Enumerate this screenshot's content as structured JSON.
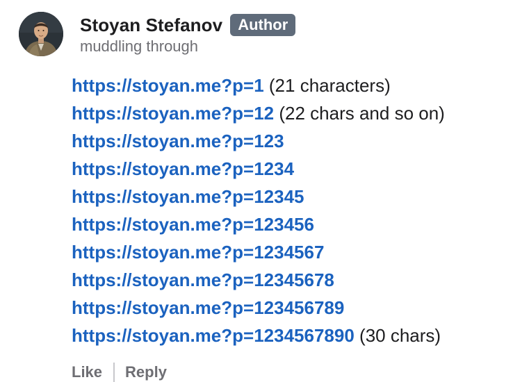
{
  "author": {
    "name": "Stoyan Stefanov",
    "badge": "Author",
    "tagline": "muddling through"
  },
  "links": [
    {
      "url": "https://stoyan.me?p=1",
      "note": "(21 characters)"
    },
    {
      "url": "https://stoyan.me?p=12",
      "note": "(22 chars and so on)"
    },
    {
      "url": "https://stoyan.me?p=123",
      "note": ""
    },
    {
      "url": "https://stoyan.me?p=1234",
      "note": ""
    },
    {
      "url": "https://stoyan.me?p=12345",
      "note": ""
    },
    {
      "url": "https://stoyan.me?p=123456",
      "note": ""
    },
    {
      "url": "https://stoyan.me?p=1234567",
      "note": ""
    },
    {
      "url": "https://stoyan.me?p=12345678",
      "note": ""
    },
    {
      "url": "https://stoyan.me?p=123456789",
      "note": ""
    },
    {
      "url": "https://stoyan.me?p=1234567890",
      "note": "(30 chars)"
    }
  ],
  "actions": {
    "like": "Like",
    "reply": "Reply"
  },
  "colors": {
    "link": "#1b62bf",
    "badge_bg": "#5f6b7a",
    "muted": "#6e6e73"
  },
  "icons": {
    "avatar": "profile-photo"
  }
}
